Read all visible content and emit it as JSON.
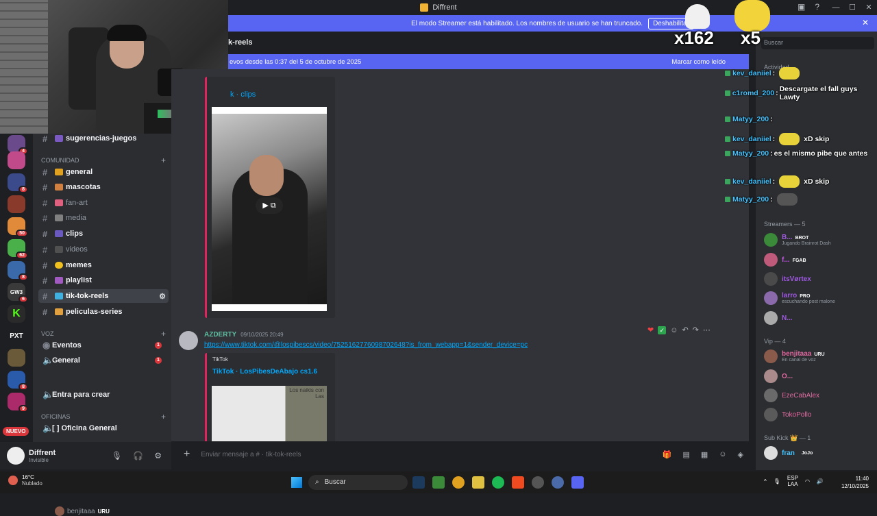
{
  "window": {
    "title": "Diffrent"
  },
  "streamer_banner": {
    "text": "El modo Streamer está habilitado. Los nombres de usuario se han truncado.",
    "button": "Deshabilitar"
  },
  "channel_header": {
    "name": "k-reels"
  },
  "new_messages_bar": {
    "text": "evos desde las 0:37 del 5 de octubre de 2025",
    "mark_read": "Marcar como leído"
  },
  "server_badges": {
    "s1": "4",
    "s2": "8",
    "s3": "8",
    "s4": "50",
    "s5": "62",
    "s6": "8",
    "s7": "6",
    "s8": "9",
    "nuevo": "NUEVO",
    "pxt": "PXT",
    "gw": "GW3"
  },
  "channels": {
    "sugerencias": "sugerencias-juegos",
    "cat_comunidad": "COMUNIDAD",
    "general": "general",
    "mascotas": "mascotas",
    "fanart": "fan-art",
    "media": "media",
    "clips": "clips",
    "videos": "videos",
    "memes": "memes",
    "playlist": "playlist",
    "tiktok": "tik-tok-reels",
    "peliculas": "peliculas-series",
    "cat_voz": "VOZ",
    "eventos": "Eventos",
    "eventos_badge": "1",
    "general_voice": "General",
    "general_voice_badge": "1",
    "voice_user": "benjitaaa",
    "voice_user_tag": "URU",
    "crear": "Entra para crear",
    "cat_oficinas": "OFICINAS",
    "oficina": "[ ] Oficina General"
  },
  "user_panel": {
    "name": "Diffrent",
    "status": "Invisible"
  },
  "chat": {
    "embed1_title": "k · clips",
    "message_author": "AZDERTY",
    "message_time": "09/10/2025 20:49",
    "message_link": "https://www.tiktok.com/@lospibescs/video/7525162776098702648?is_from_webapp=1&sender_device=pc",
    "embed2_provider": "TikTok",
    "embed2_title": "TikTok · LosPibesDeAbajo cs1.6",
    "thumb_caption_1": "Los naikis con",
    "thumb_caption_2": "Las"
  },
  "composer": {
    "placeholder": "Enviar mensaje a #  · tik-tok-reels"
  },
  "members": {
    "search": "Buscar",
    "activity": "Actividad",
    "streamers_header": "Streamers — 5",
    "s1_name": "B...",
    "s1_tag": "BROT",
    "s1_sub": "Jugando Brainrot Dash",
    "s2_name": "f...",
    "s2_tag": "FGAB",
    "s3_name": "itsVørtex",
    "s4_name": "larro",
    "s4_tag": "PRO",
    "s4_sub": "escuchando post malone",
    "s5_name": "N...",
    "vip_header": "Vip — 4",
    "v1_name": "benjitaaa",
    "v1_tag": "URU",
    "v1_sub": "En canal de voz",
    "v2_name": "O...",
    "v3_name": "EzeCabAlex",
    "v4_name": "TokoPollo",
    "sub_header": "Sub Kick 👑 — 1",
    "sub1_name": "fran",
    "sub1_tag": "JoJo"
  },
  "overlay": {
    "count1": "x162",
    "count2": "x5",
    "chat": [
      {
        "user": "kev_daniiel",
        "text": ""
      },
      {
        "user": "c1romd_200",
        "text": "Descargate el fall guys Lawty"
      },
      {
        "user": "Matyy_200",
        "text": ""
      },
      {
        "user": "kev_daniiel",
        "text": "xD skip"
      },
      {
        "user": "Matyy_200",
        "text": "es el mismo pibe que antes"
      },
      {
        "user": "kev_daniiel",
        "text": "xD skip"
      },
      {
        "user": "Matyy_200",
        "text": ""
      }
    ]
  },
  "taskbar": {
    "temp": "16°C",
    "weather": "Nublado",
    "search": "Buscar",
    "lang1": "ESP",
    "lang2": "LAA",
    "time": "11:40",
    "date": "12/10/2025"
  },
  "colors": {
    "accent": "#5865f2",
    "embed_border": "#e0245e",
    "link": "#00a8fc"
  }
}
